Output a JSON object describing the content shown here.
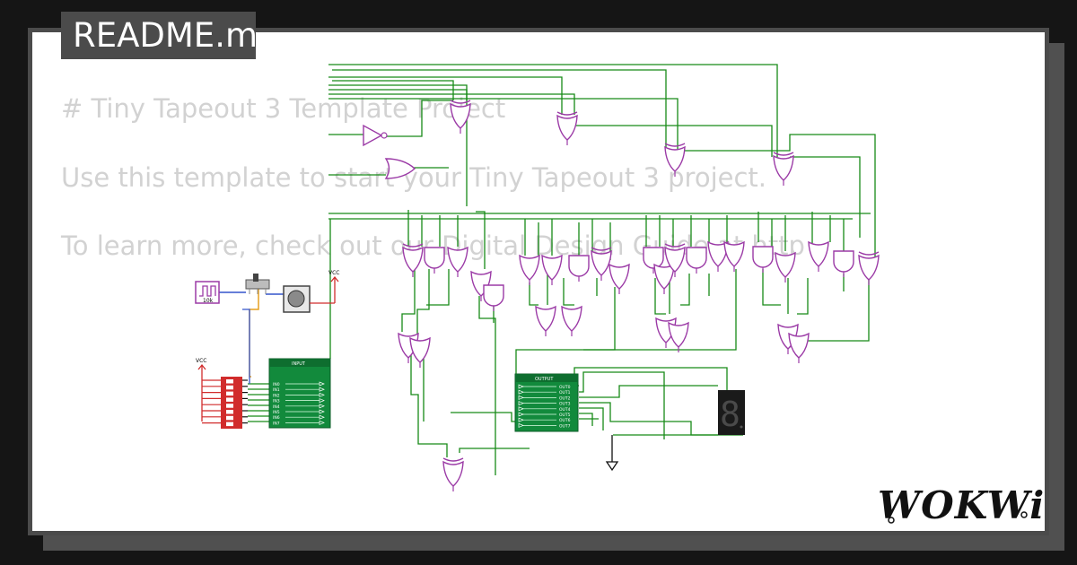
{
  "readme": {
    "tag": "README.md",
    "line1": "# Tiny Tapeout 3 Template Project",
    "line2": "Use this template to start your Tiny Tapeout 3 project.",
    "line3": "To learn more, check out our Digital Design Guide at http"
  },
  "circuit": {
    "clock_label": "10k",
    "vcc_label_1": "VCC",
    "vcc_label_2": "VCC",
    "input_label": "INPUT",
    "output_label": "OUTPUT",
    "input_pins": [
      "IN0",
      "IN1",
      "IN2",
      "IN3",
      "IN4",
      "IN5",
      "IN6",
      "IN7"
    ],
    "output_pins": [
      "OUT0",
      "OUT1",
      "OUT2",
      "OUT3",
      "OUT4",
      "OUT5",
      "OUT6",
      "OUT7"
    ],
    "seven_segment_digit": "8"
  },
  "brand": {
    "logo_text": "WOKWi"
  },
  "colors": {
    "wire": "#178a17",
    "gate": "#9b3aa6",
    "chip": "#128a3c",
    "dip": "#d12c2c",
    "display": "#1a1a1a"
  }
}
